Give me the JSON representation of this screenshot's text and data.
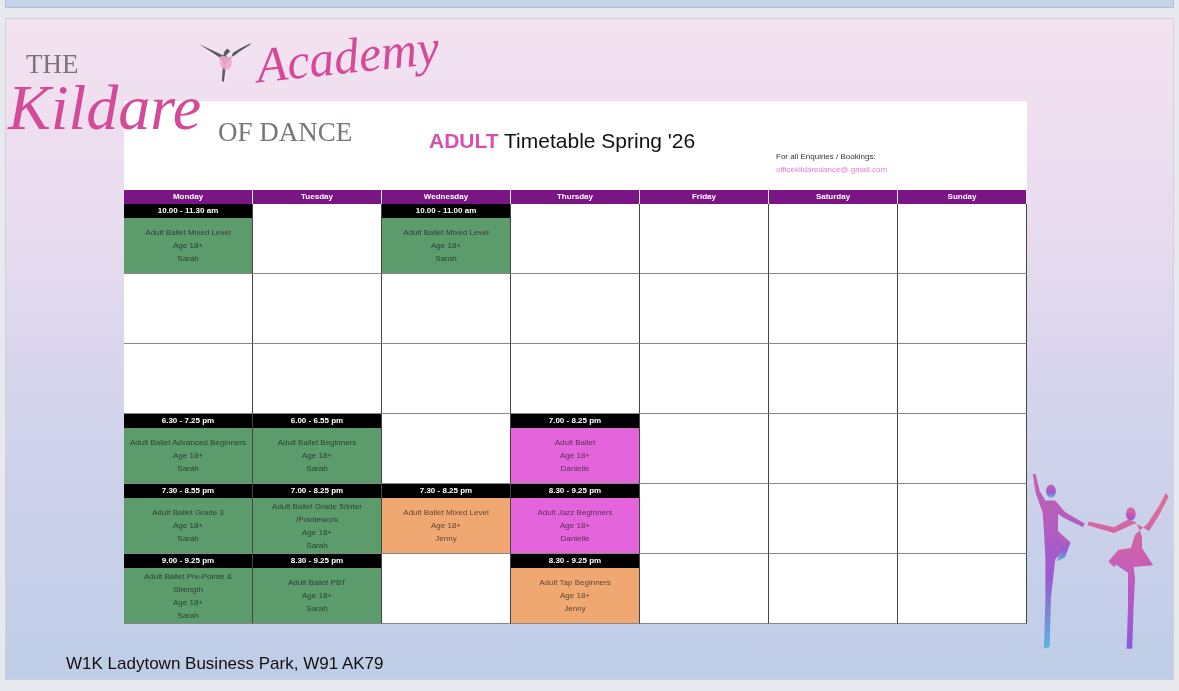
{
  "logo": {
    "line_1": "THE",
    "line_2": "Kildare",
    "line_3": "Academy",
    "line_4": "OF DANCE"
  },
  "timetable": {
    "title_highlight": "ADULT",
    "title": "Timetable Spring '26",
    "enquiries_label": "For all Enquiries / Bookings:",
    "email": "officekildaredance@ gmail.com",
    "days": [
      "Monday",
      "Tuesday",
      "Wednesday",
      "Thursday",
      "Friday",
      "Saturday",
      "Sunday"
    ],
    "rows": [
      [
        {
          "kind": "class",
          "time": "10.00 - 11.30 am",
          "name": "Adult Ballet Mixed Level",
          "age": "Age 18+",
          "teacher": "Sarah",
          "color": "#5c9c6c"
        },
        {
          "kind": "empty"
        },
        {
          "kind": "class",
          "time": "10.00 - 11.00 am",
          "name": "Adult Ballet Mixed Level",
          "age": "Age 18+",
          "teacher": "Sarah",
          "color": "#5c9c6c"
        },
        {
          "kind": "empty"
        },
        {
          "kind": "empty"
        },
        {
          "kind": "empty"
        },
        {
          "kind": "empty"
        }
      ],
      [
        {
          "kind": "empty"
        },
        {
          "kind": "empty"
        },
        {
          "kind": "empty"
        },
        {
          "kind": "empty"
        },
        {
          "kind": "empty"
        },
        {
          "kind": "empty"
        },
        {
          "kind": "empty"
        }
      ],
      [
        {
          "kind": "empty"
        },
        {
          "kind": "empty"
        },
        {
          "kind": "empty"
        },
        {
          "kind": "empty"
        },
        {
          "kind": "empty"
        },
        {
          "kind": "empty"
        },
        {
          "kind": "empty"
        }
      ],
      [
        {
          "kind": "class",
          "time": "6.30 - 7.25 pm",
          "name": "Adult Ballet Advanced Beginners",
          "age": "Age 18+",
          "teacher": "Sarah",
          "color": "#5c9c6c"
        },
        {
          "kind": "class",
          "time": "6.00 - 6.55 pm",
          "name": "Adult Ballet Beginners",
          "age": "Age 18+",
          "teacher": "Sarah",
          "color": "#5c9c6c"
        },
        {
          "kind": "empty"
        },
        {
          "kind": "class",
          "time": "7.00 - 8.25 pm",
          "name": "Adult Ballet",
          "age": "Age 18+",
          "teacher": "Danielle",
          "color": "#e464dc"
        },
        {
          "kind": "empty"
        },
        {
          "kind": "empty"
        },
        {
          "kind": "empty"
        }
      ],
      [
        {
          "kind": "class",
          "time": "7.30 - 8.55 pm",
          "name": "Adult Ballet Grade 3",
          "age": "Age 18+",
          "teacher": "Sarah",
          "color": "#5c9c6c"
        },
        {
          "kind": "class",
          "time": "7.00 - 8.25 pm",
          "name": "Adult Ballet Grade 5/Inter /Pointework",
          "age": "Age 18+",
          "teacher": "Sarah",
          "color": "#5c9c6c"
        },
        {
          "kind": "class",
          "time": "7.30 - 8.25 pm",
          "name": "Adult Ballet Mixed Level",
          "age": "Age 18+",
          "teacher": "Jenny",
          "color": "#f0a872"
        },
        {
          "kind": "class",
          "time": "8.30 - 9.25 pm",
          "name": "Adult Jazz Beginners",
          "age": "Age 18+",
          "teacher": "Danielle",
          "color": "#e464dc"
        },
        {
          "kind": "empty"
        },
        {
          "kind": "empty"
        },
        {
          "kind": "empty"
        }
      ],
      [
        {
          "kind": "class",
          "time": "9.00 - 9.25 pm",
          "name": "Adult Ballet Pre-Pointe & Strength",
          "age": "Age 18+",
          "teacher": "Sarah",
          "color": "#5c9c6c"
        },
        {
          "kind": "class",
          "time": "8.30 - 9.25 pm",
          "name": "Adult Ballet PBT",
          "age": "Age 18+",
          "teacher": "Sarah",
          "color": "#5c9c6c"
        },
        {
          "kind": "empty"
        },
        {
          "kind": "class",
          "time": "8.30 - 9.25 pm",
          "name": "Adult Tap Beginners",
          "age": "Age 18+",
          "teacher": "Jenny",
          "color": "#f0a872"
        },
        {
          "kind": "empty"
        },
        {
          "kind": "empty"
        },
        {
          "kind": "empty"
        }
      ]
    ]
  },
  "address": "W1K Ladytown Business Park, W91 AK79"
}
